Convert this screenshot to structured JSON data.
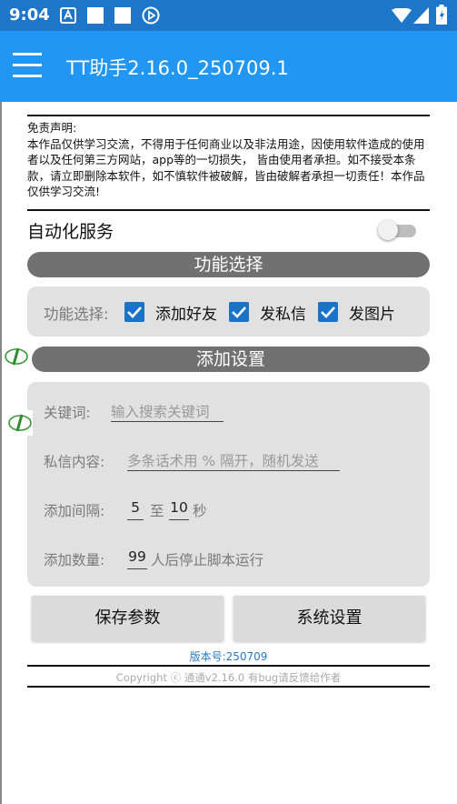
{
  "status_bar": {
    "time": "9:04"
  },
  "app_bar": {
    "title": "TT助手2.16.0_250709.1"
  },
  "disclaimer": {
    "title": "免责声明:",
    "body": "本作品仅供学习交流，不得用于任何商业以及非法用途，因使用软件造成的使用者以及任何第三方网站，app等的一切损失， 皆由使用者承担。如不接受本条款，请立即删除本软件，如不慎软件被破解，皆由破解者承担一切责任！本作品仅供学习交流!"
  },
  "automation": {
    "label": "自动化服务",
    "enabled": false
  },
  "function_section": {
    "header": "功能选择",
    "label": "功能选择:",
    "options": [
      {
        "label": "添加好友",
        "checked": true
      },
      {
        "label": "发私信",
        "checked": true
      },
      {
        "label": "发图片",
        "checked": true
      }
    ]
  },
  "add_settings": {
    "header": "添加设置",
    "keyword": {
      "label": "关键词:",
      "placeholder": "输入搜索关键词"
    },
    "message": {
      "label": "私信内容:",
      "placeholder": "多条话术用 % 隔开，随机发送"
    },
    "interval": {
      "label": "添加间隔:",
      "from": "5",
      "to_label": "至",
      "to": "10",
      "unit": "秒"
    },
    "count": {
      "label": "添加数量:",
      "value": "99",
      "suffix": "人后停止脚本运行"
    }
  },
  "buttons": {
    "save": "保存参数",
    "system": "系统设置"
  },
  "footer": {
    "version": "版本号:250709",
    "copyright": "Copyright ⓒ 通通v2.16.0  有bug请反馈给作者"
  },
  "colors": {
    "status_bar": "#1d76c9",
    "app_bar": "#2196f3",
    "checkbox": "#1a73c6",
    "section_bar": "#717171"
  }
}
